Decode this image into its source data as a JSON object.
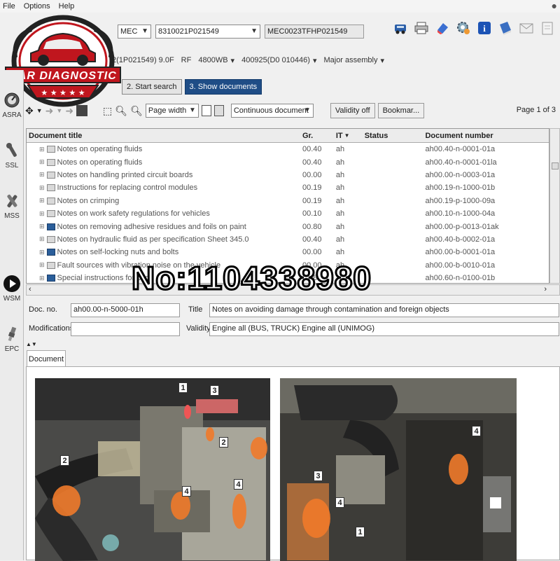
{
  "menu": [
    "File",
    "Options",
    "Help"
  ],
  "selection": {
    "model_combo": "MEC",
    "vin_combo": "8310021P021549",
    "code_field": "MEC0023TFHP021549",
    "row2": [
      "2(1P021549) 9.0F",
      "RF",
      "4800WB",
      "400925(D0 010446)",
      "Major assembly"
    ]
  },
  "logo": {
    "text": "CAR DIAGNOSTIC"
  },
  "sidebar": [
    {
      "label": "ASRA",
      "icon": "gauge-icon"
    },
    {
      "label": "SSL",
      "icon": "wrench-icon"
    },
    {
      "label": "MSS",
      "icon": "tools-icon"
    },
    {
      "label": "WSM",
      "icon": "play-icon"
    },
    {
      "label": "EPC",
      "icon": "spark-plug-icon"
    }
  ],
  "steps": {
    "start_search": "2. Start search",
    "show_documents": "3. Show documents"
  },
  "doc_toolbar": {
    "zoom": "Page width",
    "view_mode": "Continuous document",
    "validity": "Validity off",
    "bookmark": "Bookmar...",
    "page_label": "Page 1 of 3"
  },
  "table": {
    "headers": [
      "Document title",
      "Gr.",
      "IT",
      "Status",
      "Document number"
    ],
    "rows": [
      {
        "title": "Notes on operating fluids",
        "gr": "00.40",
        "it": "ah",
        "status": "",
        "num": "ah00.40-n-0001-01a",
        "blue": false
      },
      {
        "title": "Notes on operating fluids",
        "gr": "00.40",
        "it": "ah",
        "status": "",
        "num": "ah00.40-n-0001-01la",
        "blue": false
      },
      {
        "title": "Notes on handling printed circuit boards",
        "gr": "00.00",
        "it": "ah",
        "status": "",
        "num": "ah00.00-n-0003-01a",
        "blue": false
      },
      {
        "title": "Instructions for replacing control modules",
        "gr": "00.19",
        "it": "ah",
        "status": "",
        "num": "ah00.19-n-1000-01b",
        "blue": false
      },
      {
        "title": "Notes on crimping",
        "gr": "00.19",
        "it": "ah",
        "status": "",
        "num": "ah00.19-p-1000-09a",
        "blue": false
      },
      {
        "title": "Notes on work safety regulations for vehicles",
        "gr": "00.10",
        "it": "ah",
        "status": "",
        "num": "ah00.10-n-1000-04a",
        "blue": false
      },
      {
        "title": "Notes on removing adhesive residues and foils on paint",
        "gr": "00.80",
        "it": "ah",
        "status": "",
        "num": "ah00.00-p-0013-01ak",
        "blue": true
      },
      {
        "title": "Notes on hydraulic fluid as per specification Sheet 345.0",
        "gr": "00.40",
        "it": "ah",
        "status": "",
        "num": "ah00.40-b-0002-01a",
        "blue": false
      },
      {
        "title": "Notes on self-locking nuts and bolts",
        "gr": "00.00",
        "it": "ah",
        "status": "",
        "num": "ah00.00-b-0001-01a",
        "blue": true
      },
      {
        "title": "Fault sources with vibration noise on the vehicle",
        "gr": "00.00",
        "it": "ah",
        "status": "",
        "num": "ah00.00-b-0010-01a",
        "blue": false
      },
      {
        "title": "Special instructions for body",
        "gr": "00.60",
        "it": "ah",
        "status": "",
        "num": "ah00.60-n-0100-01b",
        "blue": true
      }
    ]
  },
  "details": {
    "doc_no_label": "Doc. no.",
    "doc_no": "ah00.00-n-5000-01h",
    "title_label": "Title",
    "title": "Notes on avoiding damage through contamination and foreign objects",
    "modifications_label": "Modifications",
    "validity_label": "Validity",
    "validity": "Engine all (BUS, TRUCK) Engine all (UNIMOG)"
  },
  "document_tab": "Document",
  "callouts_left": [
    "1",
    "3",
    "2",
    "2",
    "4",
    "4"
  ],
  "callouts_right": [
    "4",
    "3",
    "4",
    "1"
  ],
  "watermark": "No:1104338980",
  "colors": {
    "active_tab": "#1f4d86",
    "callout_orange": "#f07a2a",
    "logo_red": "#c0161e"
  }
}
